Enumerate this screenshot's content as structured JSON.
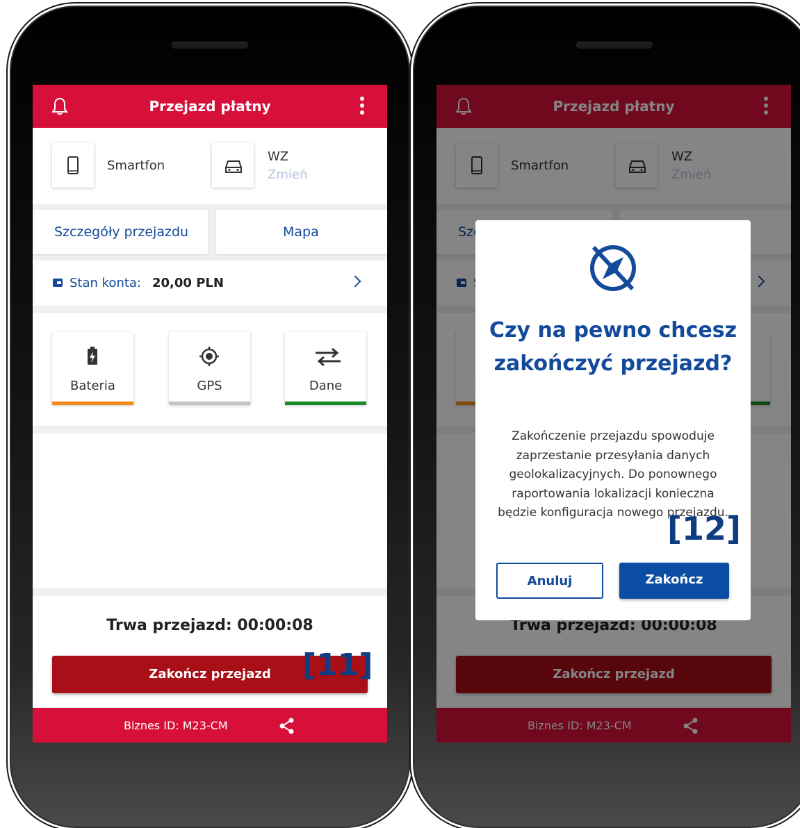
{
  "screen": {
    "header_title": "Przejazd płatny",
    "device_label": "Smartfon",
    "vehicle_label": "WZ",
    "vehicle_change": "Zmień",
    "tab_details": "Szczegóły przejazdu",
    "tab_map": "Mapa",
    "balance_label": "Stan konta:",
    "balance_value": "20,00 PLN",
    "status_battery": "Bateria",
    "status_gps": "GPS",
    "status_data": "Dane",
    "timer_text": "Trwa przejazd: 00:00:08",
    "end_button": "Zakończ przejazd",
    "footer_id": "Biznes ID:  M23-CM"
  },
  "status_colors": {
    "battery": "#f08a1c",
    "gps": "#c4c4c4",
    "data": "#1a8a2a"
  },
  "dialog": {
    "title": "Czy na pewno chcesz zakończyć przejazd?",
    "body": "Zakończenie przejazdu spowoduje zaprzestanie przesyłania danych geolokalizacyjnych. Do ponownego raportowania lokalizacji konieczna będzie konfiguracja nowego przejazdu.",
    "cancel": "Anuluj",
    "confirm": "Zakończ",
    "icon": "gps-off-icon"
  },
  "markers": {
    "left": "[11]",
    "right": "[12]"
  },
  "colors": {
    "primary_red": "#d7103a",
    "dark_red": "#a80f17",
    "blue": "#134a9a"
  }
}
